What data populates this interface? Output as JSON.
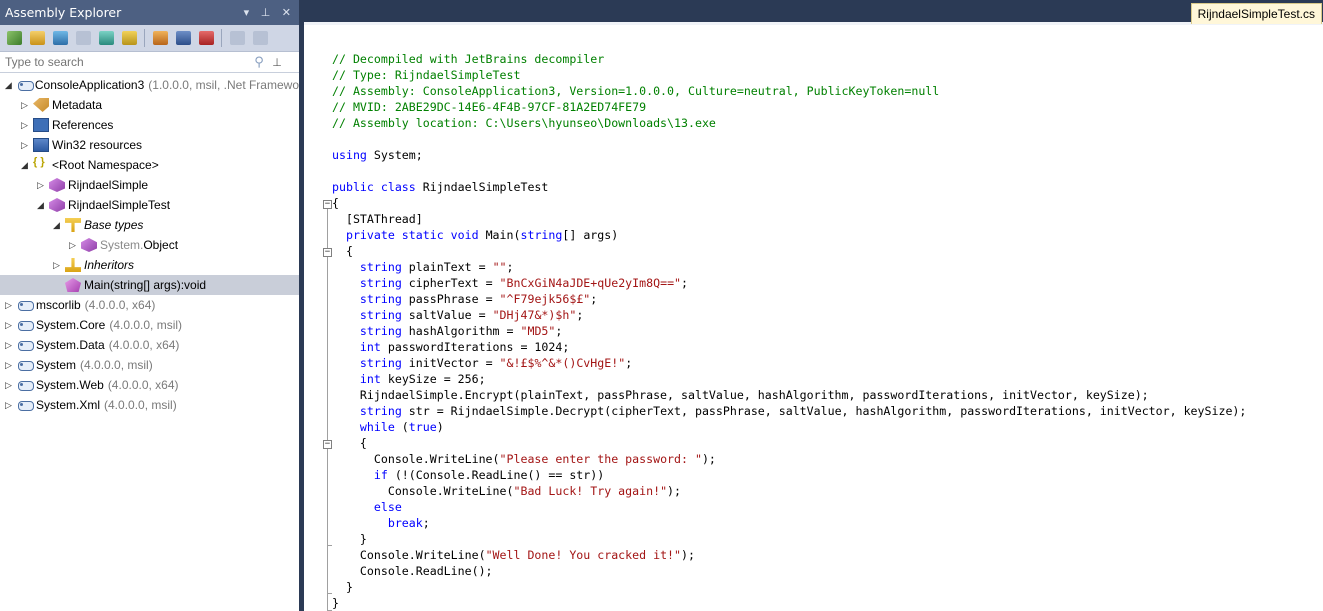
{
  "explorer": {
    "title": "Assembly Explorer",
    "title_controls": "▾ ⊥ ✕",
    "search_placeholder": "Type to search",
    "tree": [
      {
        "id": "consoleapp3",
        "label": "ConsoleApplication3",
        "meta": "(1.0.0.0, msil, .Net Framewo",
        "icon": "assembly-icon",
        "indent": 0,
        "toggle": "expanded"
      },
      {
        "id": "metadata",
        "label": "Metadata",
        "meta": "",
        "icon": "metadata-icon",
        "indent": 1,
        "toggle": "collapsed"
      },
      {
        "id": "references",
        "label": "References",
        "meta": "",
        "icon": "references-icon",
        "indent": 1,
        "toggle": "collapsed"
      },
      {
        "id": "win32res",
        "label": "Win32 resources",
        "meta": "",
        "icon": "win32-resources-icon",
        "indent": 1,
        "toggle": "collapsed"
      },
      {
        "id": "rootns",
        "label": "<Root Namespace>",
        "meta": "",
        "icon": "namespace-icon",
        "indent": 1,
        "toggle": "expanded"
      },
      {
        "id": "rijndaelsimple",
        "label": "RijndaelSimple",
        "meta": "",
        "icon": "class-icon",
        "indent": 2,
        "toggle": "collapsed"
      },
      {
        "id": "rijndaelsimpletest",
        "label": "RijndaelSimpleTest",
        "meta": "",
        "icon": "class-icon",
        "indent": 2,
        "toggle": "expanded"
      },
      {
        "id": "basetypes",
        "label": "Base types",
        "meta": "",
        "icon": "base-types-icon",
        "indent": 3,
        "toggle": "expanded",
        "italic": true
      },
      {
        "id": "sysobject",
        "label_prefix": "System.",
        "label": "Object",
        "meta": "",
        "icon": "class-icon",
        "indent": 4,
        "toggle": "collapsed"
      },
      {
        "id": "inheritors",
        "label": "Inheritors",
        "meta": "",
        "icon": "inheritors-icon",
        "indent": 3,
        "toggle": "collapsed",
        "italic": true
      },
      {
        "id": "mainmethod",
        "label": "Main(string[] args):void",
        "meta": "",
        "icon": "method-icon",
        "indent": 3,
        "toggle": "none",
        "selected": true
      },
      {
        "id": "mscorlib",
        "label": "mscorlib",
        "meta": "(4.0.0.0, x64)",
        "icon": "assembly-icon",
        "indent": 0,
        "toggle": "collapsed"
      },
      {
        "id": "syscore",
        "label": "System.Core",
        "meta": "(4.0.0.0, msil)",
        "icon": "assembly-icon",
        "indent": 0,
        "toggle": "collapsed"
      },
      {
        "id": "sysdata",
        "label": "System.Data",
        "meta": "(4.0.0.0, x64)",
        "icon": "assembly-icon",
        "indent": 0,
        "toggle": "collapsed"
      },
      {
        "id": "system",
        "label": "System",
        "meta": "(4.0.0.0, msil)",
        "icon": "assembly-icon",
        "indent": 0,
        "toggle": "collapsed"
      },
      {
        "id": "sysweb",
        "label": "System.Web",
        "meta": "(4.0.0.0, x64)",
        "icon": "assembly-icon",
        "indent": 0,
        "toggle": "collapsed"
      },
      {
        "id": "sysxml",
        "label": "System.Xml",
        "meta": "(4.0.0.0, msil)",
        "icon": "assembly-icon",
        "indent": 0,
        "toggle": "collapsed"
      }
    ]
  },
  "editor": {
    "tab": "RijndaelSimpleTest.cs",
    "lines": [
      [
        [
          "cm",
          "// Decompiled with JetBrains decompiler"
        ]
      ],
      [
        [
          "cm",
          "// Type: RijndaelSimpleTest"
        ]
      ],
      [
        [
          "cm",
          "// Assembly: ConsoleApplication3, Version=1.0.0.0, Culture=neutral, PublicKeyToken=null"
        ]
      ],
      [
        [
          "cm",
          "// MVID: 2ABE29DC-14E6-4F4B-97CF-81A2ED74FE79"
        ]
      ],
      [
        [
          "cm",
          "// Assembly location: C:\\Users\\hyunseo\\Downloads\\13.exe"
        ]
      ],
      [],
      [
        [
          "kw",
          "using"
        ],
        [
          "pl",
          " System;"
        ]
      ],
      [],
      [
        [
          "kw",
          "public class"
        ],
        [
          "pl",
          " RijndaelSimpleTest"
        ]
      ],
      [
        [
          "pl",
          "{"
        ]
      ],
      [
        [
          "pl",
          "  [STAThread]"
        ]
      ],
      [
        [
          "kw",
          "  private static void"
        ],
        [
          "pl",
          " Main("
        ],
        [
          "kw",
          "string"
        ],
        [
          "pl",
          "[] args)"
        ]
      ],
      [
        [
          "pl",
          "  {"
        ]
      ],
      [
        [
          "kw",
          "    string"
        ],
        [
          "pl",
          " plainText = "
        ],
        [
          "st",
          "\"\""
        ],
        [
          "pl",
          ";"
        ]
      ],
      [
        [
          "kw",
          "    string"
        ],
        [
          "pl",
          " cipherText = "
        ],
        [
          "st",
          "\"BnCxGiN4aJDE+qUe2yIm8Q==\""
        ],
        [
          "pl",
          ";"
        ]
      ],
      [
        [
          "kw",
          "    string"
        ],
        [
          "pl",
          " passPhrase = "
        ],
        [
          "st",
          "\"^F79ejk56$£\""
        ],
        [
          "pl",
          ";"
        ]
      ],
      [
        [
          "kw",
          "    string"
        ],
        [
          "pl",
          " saltValue = "
        ],
        [
          "st",
          "\"DHj47&*)$h\""
        ],
        [
          "pl",
          ";"
        ]
      ],
      [
        [
          "kw",
          "    string"
        ],
        [
          "pl",
          " hashAlgorithm = "
        ],
        [
          "st",
          "\"MD5\""
        ],
        [
          "pl",
          ";"
        ]
      ],
      [
        [
          "kw",
          "    int"
        ],
        [
          "pl",
          " passwordIterations = 1024;"
        ]
      ],
      [
        [
          "kw",
          "    string"
        ],
        [
          "pl",
          " initVector = "
        ],
        [
          "st",
          "\"&!£$%^&*()CvHgE!\""
        ],
        [
          "pl",
          ";"
        ]
      ],
      [
        [
          "kw",
          "    int"
        ],
        [
          "pl",
          " keySize = 256;"
        ]
      ],
      [
        [
          "pl",
          "    RijndaelSimple.Encrypt(plainText, passPhrase, saltValue, hashAlgorithm, passwordIterations, initVector, keySize);"
        ]
      ],
      [
        [
          "kw",
          "    string"
        ],
        [
          "pl",
          " str = RijndaelSimple.Decrypt(cipherText, passPhrase, saltValue, hashAlgorithm, passwordIterations, initVector, keySize);"
        ]
      ],
      [
        [
          "kw",
          "    while"
        ],
        [
          "pl",
          " ("
        ],
        [
          "kw",
          "true"
        ],
        [
          "pl",
          ")"
        ]
      ],
      [
        [
          "pl",
          "    {"
        ]
      ],
      [
        [
          "pl",
          "      Console.WriteLine("
        ],
        [
          "st",
          "\"Please enter the password: \""
        ],
        [
          "pl",
          ");"
        ]
      ],
      [
        [
          "kw",
          "      if"
        ],
        [
          "pl",
          " (!(Console.ReadLine() == str))"
        ]
      ],
      [
        [
          "pl",
          "        Console.WriteLine("
        ],
        [
          "st",
          "\"Bad Luck! Try again!\""
        ],
        [
          "pl",
          ");"
        ]
      ],
      [
        [
          "kw",
          "      else"
        ]
      ],
      [
        [
          "kw",
          "        break"
        ],
        [
          "pl",
          ";"
        ]
      ],
      [
        [
          "pl",
          "    }"
        ]
      ],
      [
        [
          "pl",
          "    Console.WriteLine("
        ],
        [
          "st",
          "\"Well Done! You cracked it!\""
        ],
        [
          "pl",
          ");"
        ]
      ],
      [
        [
          "pl",
          "    Console.ReadLine();"
        ]
      ],
      [
        [
          "pl",
          "  }"
        ]
      ],
      [
        [
          "pl",
          "}"
        ]
      ]
    ]
  },
  "colors": {
    "comment": "#008000",
    "keyword": "#0000ff",
    "string": "#a31515",
    "panel_title": "#4d6082",
    "toolbar": "#cfd6e5",
    "selection": "#c9ced9"
  }
}
